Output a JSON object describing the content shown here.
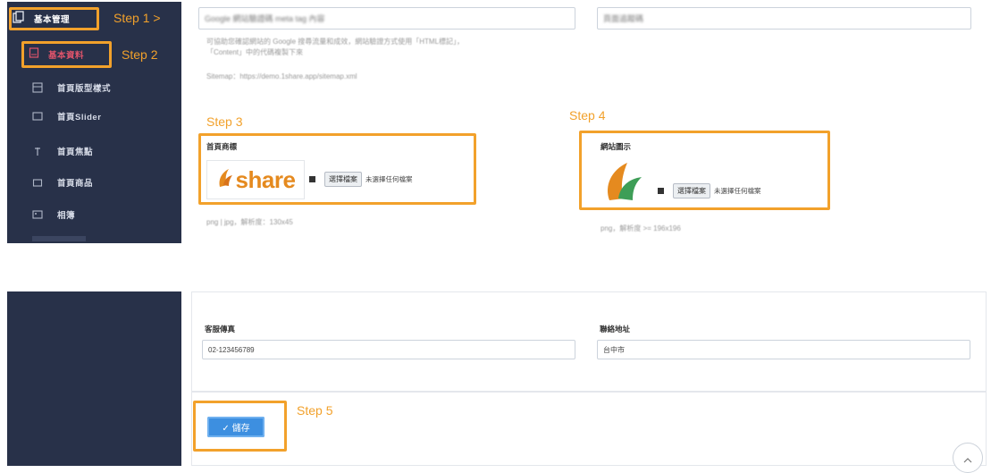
{
  "sidebar": {
    "items": [
      {
        "label": "基本資料",
        "icon": "document-icon"
      },
      {
        "label": "首頁版型樣式",
        "icon": "layout-icon"
      },
      {
        "label": "首頁Slider",
        "icon": "image-icon"
      },
      {
        "label": "首頁焦點",
        "icon": "pin-icon"
      },
      {
        "label": "首頁商品",
        "icon": "box-icon"
      },
      {
        "label": "相簿",
        "icon": "album-icon"
      }
    ],
    "top_item": {
      "label": "基本管理",
      "icon": "copy-icon"
    }
  },
  "steps": {
    "step1": "Step 1 >",
    "step2": "Step 2",
    "step3": "Step 3",
    "step4": "Step 4",
    "step5": "Step 5"
  },
  "top_form": {
    "blurred_input_left": "Google 網站驗證碼 meta tag 內容",
    "blurred_input_right": "頁面追蹤碼",
    "help_line1": "可協助您確認網站的 Google 搜尋流量和成效，網站驗證方式使用「HTML標記」，",
    "help_line2": "「Content」中的代碼複製下來",
    "help_line3": "Sitemap：https://demo.1share.app/sitemap.xml"
  },
  "logo_section": {
    "label": "首頁商標",
    "logo_text": "share",
    "choose_file": "選擇檔案",
    "no_file": "未選擇任何檔案",
    "hint": "png | jpg，解析度：130x45"
  },
  "favicon_section": {
    "label": "網站圖示",
    "choose_file": "選擇檔案",
    "no_file": "未選擇任何檔案",
    "hint": "png，解析度 >= 196x196"
  },
  "bottom_form": {
    "fax_label": "客服傳真",
    "fax_value": "02-123456789",
    "address_label": "聯絡地址",
    "address_value": "台中市",
    "save_label": "✓ 儲存"
  },
  "colors": {
    "sidebar_bg": "#283149",
    "step_orange": "#f2a12b",
    "save_blue": "#3d8fe0",
    "active_red": "#e0546b"
  }
}
